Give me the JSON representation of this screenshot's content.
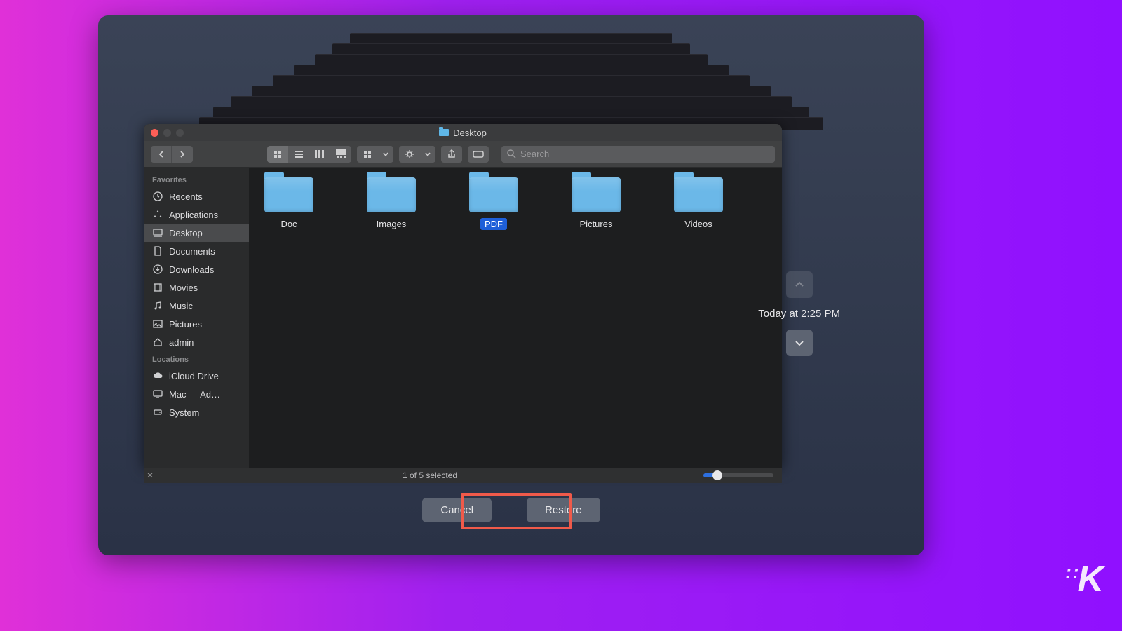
{
  "window": {
    "title": "Desktop"
  },
  "search": {
    "placeholder": "Search"
  },
  "sidebar": {
    "sections": [
      {
        "header": "Favorites",
        "items": [
          {
            "icon": "clock",
            "label": "Recents"
          },
          {
            "icon": "apps",
            "label": "Applications"
          },
          {
            "icon": "desktop",
            "label": "Desktop",
            "selected": true
          },
          {
            "icon": "doc",
            "label": "Documents"
          },
          {
            "icon": "download",
            "label": "Downloads"
          },
          {
            "icon": "film",
            "label": "Movies"
          },
          {
            "icon": "music",
            "label": "Music"
          },
          {
            "icon": "photo",
            "label": "Pictures"
          },
          {
            "icon": "home",
            "label": "admin"
          }
        ]
      },
      {
        "header": "Locations",
        "items": [
          {
            "icon": "cloud",
            "label": "iCloud Drive"
          },
          {
            "icon": "monitor",
            "label": "Mac — Ad…"
          },
          {
            "icon": "hdd",
            "label": "System"
          }
        ]
      }
    ]
  },
  "folders": [
    {
      "label": "Doc"
    },
    {
      "label": "Images"
    },
    {
      "label": "PDF",
      "selected": true
    },
    {
      "label": "Pictures"
    },
    {
      "label": "Videos"
    }
  ],
  "statusbar": {
    "text": "1 of 5 selected"
  },
  "buttons": {
    "cancel": "Cancel",
    "restore": "Restore"
  },
  "timeline": {
    "label": "Today at 2:25 PM"
  }
}
